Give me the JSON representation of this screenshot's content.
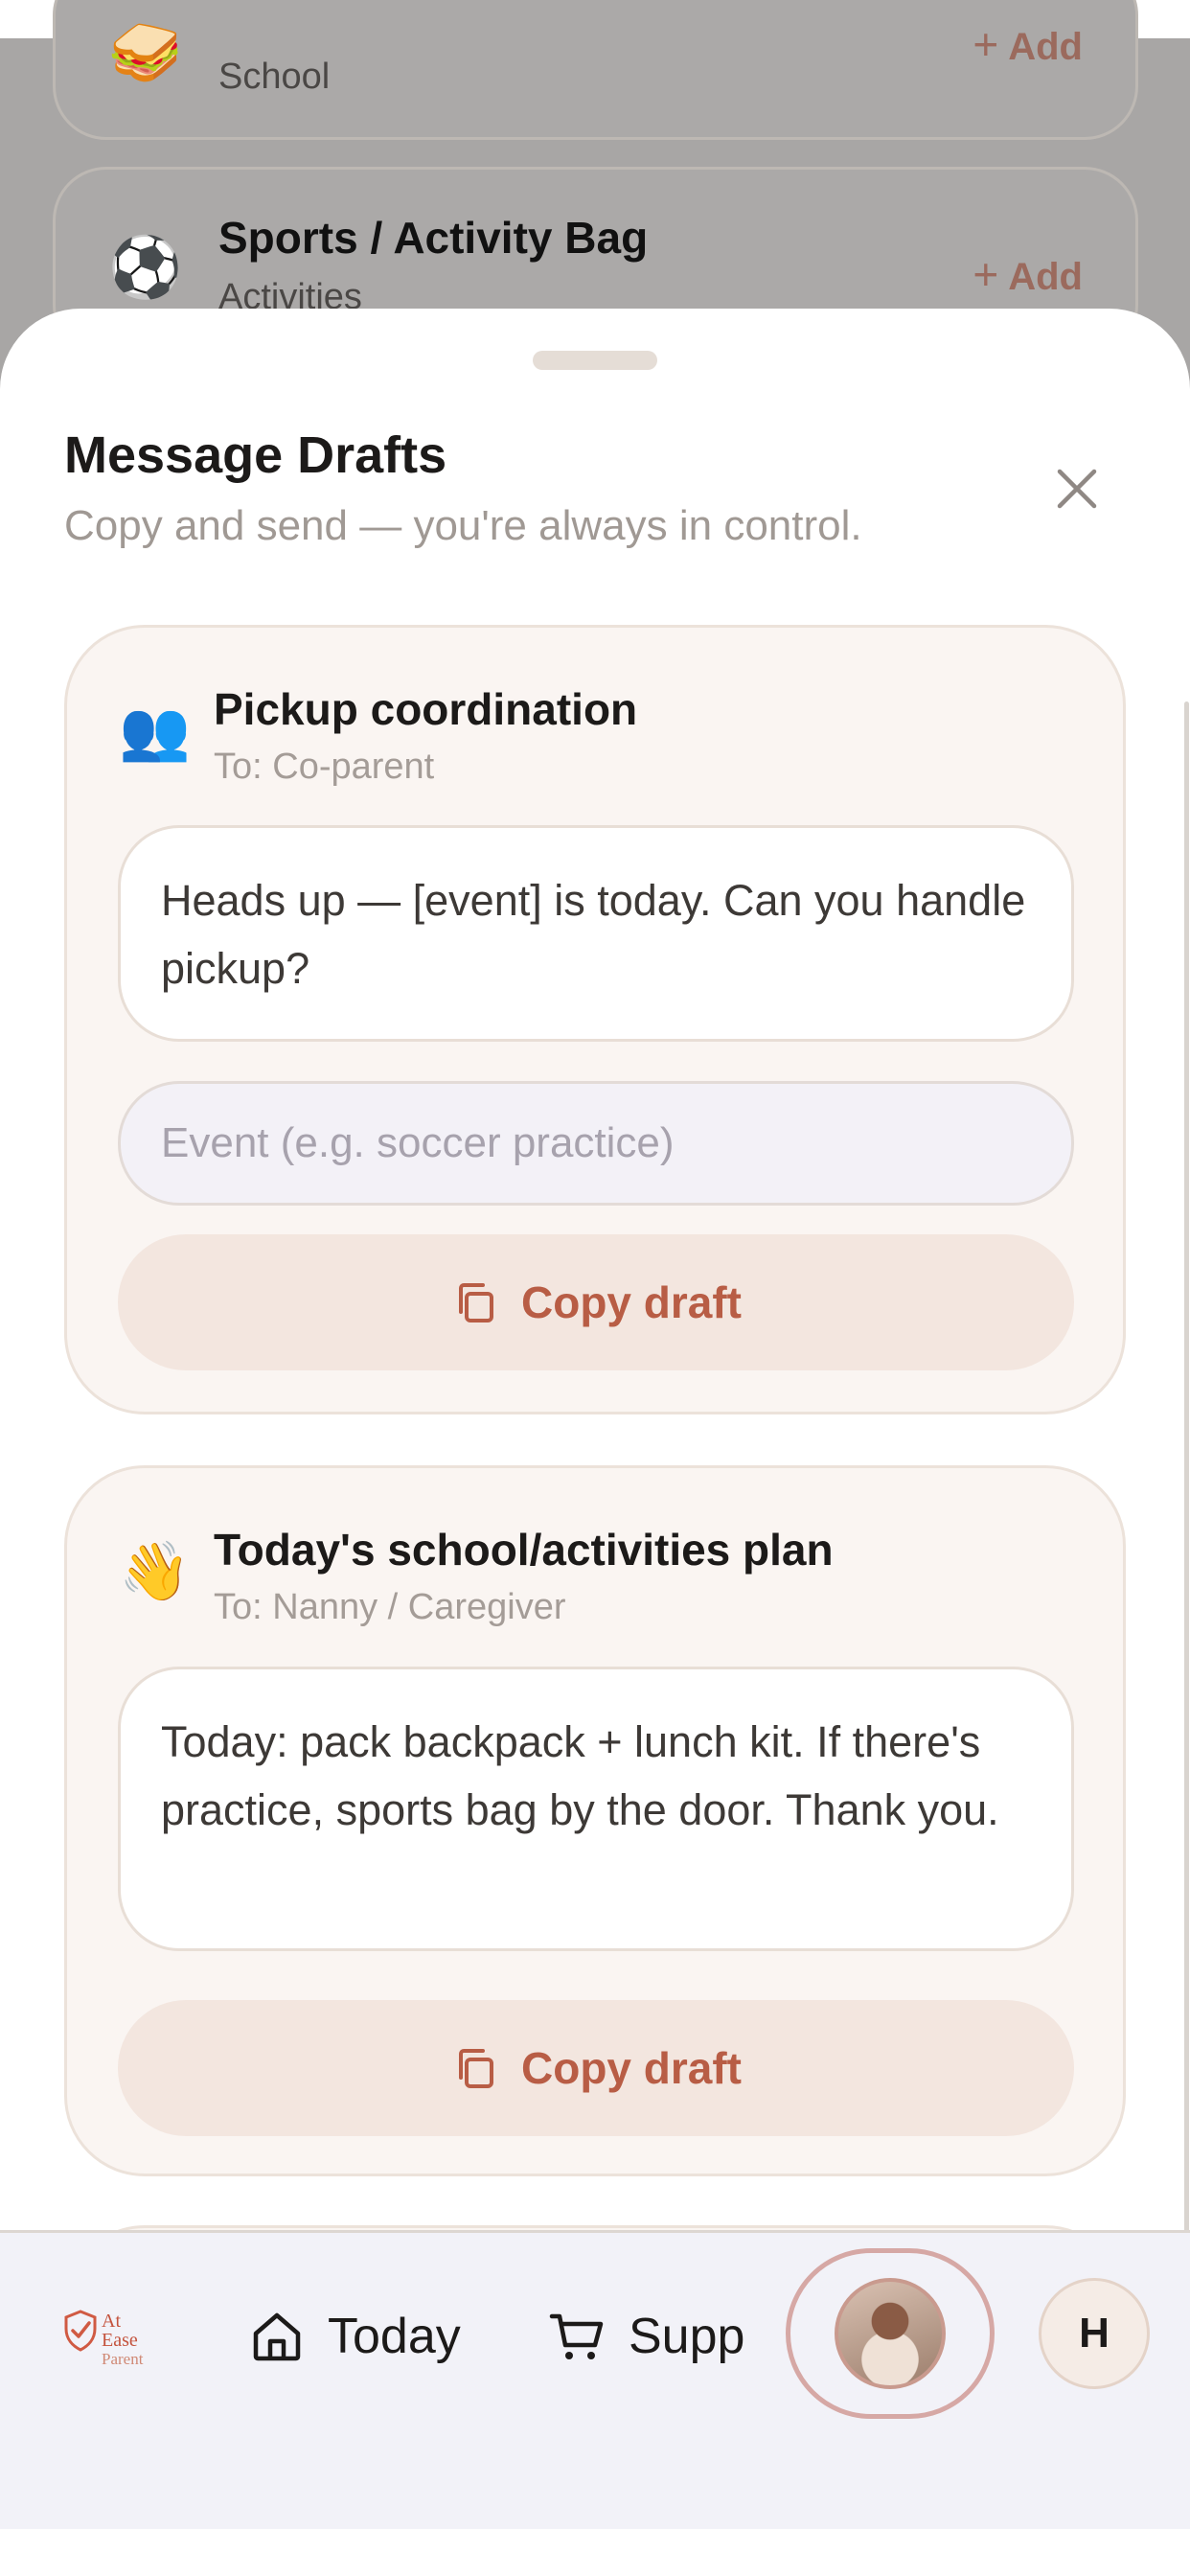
{
  "background_list": {
    "items": [
      {
        "emoji": "🥪",
        "subtitle": "School",
        "add_label": "Add"
      },
      {
        "emoji": "⚽",
        "title": "Sports / Activity Bag",
        "subtitle": "Activities",
        "add_label": "Add"
      }
    ]
  },
  "sheet": {
    "title": "Message Drafts",
    "subtitle": "Copy and send — you're always in control.",
    "close_icon": "close-icon"
  },
  "drafts": [
    {
      "emoji": "👥",
      "title": "Pickup coordination",
      "recipient": "To: Co-parent",
      "message": "Heads up — [event] is today. Can you handle pickup?",
      "input_placeholder": "Event (e.g. soccer practice)",
      "input_value": "",
      "button_label": "Copy draft"
    },
    {
      "emoji": "👋",
      "title": "Today's school/activities plan",
      "recipient": "To: Nanny / Caregiver",
      "message": "Today: pack backpack + lunch kit. If there's practice, sports bag by the door. Thank you.",
      "button_label": "Copy draft"
    }
  ],
  "bottom_nav": {
    "logo_line1": "At Ease",
    "logo_line2": "Parent",
    "items": [
      {
        "label": "Today",
        "icon": "home-icon"
      },
      {
        "label": "Supp",
        "icon": "cart-icon"
      }
    ],
    "profile_initial": "H"
  },
  "colors": {
    "accent": "#b85d45",
    "card_bg": "#faf5f2",
    "button_bg": "#f3e6df",
    "nav_bg": "#f2f2f8"
  }
}
